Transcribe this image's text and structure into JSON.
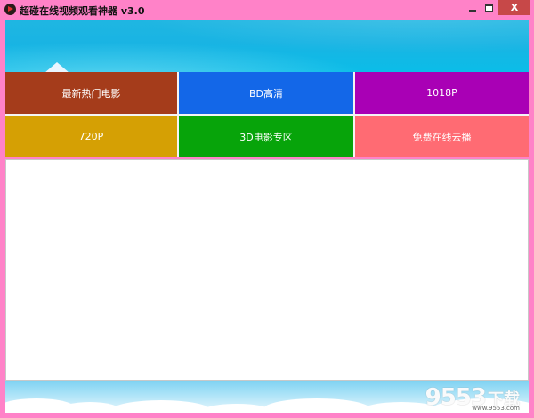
{
  "window": {
    "title": "超碰在线视频观看神器 v3.0",
    "close_label": "X"
  },
  "tiles": [
    {
      "label": "最新热门电影",
      "color": "#a53c1b"
    },
    {
      "label": "BD高清",
      "color": "#1367e8"
    },
    {
      "label": "1018P",
      "color": "#a900b5"
    },
    {
      "label": "720P",
      "color": "#d5a004"
    },
    {
      "label": "3D电影专区",
      "color": "#07a40a"
    },
    {
      "label": "免费在线云播",
      "color": "#ff6b73"
    }
  ],
  "watermark": {
    "number": "9553",
    "chinese": "下载",
    "url": "www.9553.com"
  },
  "colors": {
    "frame": "#ff82c8",
    "banner": "#19b4e3",
    "content_bg": "#ffffff"
  },
  "icons": {
    "app": "play-icon",
    "minimize": "minimize-icon",
    "maximize": "maximize-icon",
    "close": "close-icon"
  }
}
